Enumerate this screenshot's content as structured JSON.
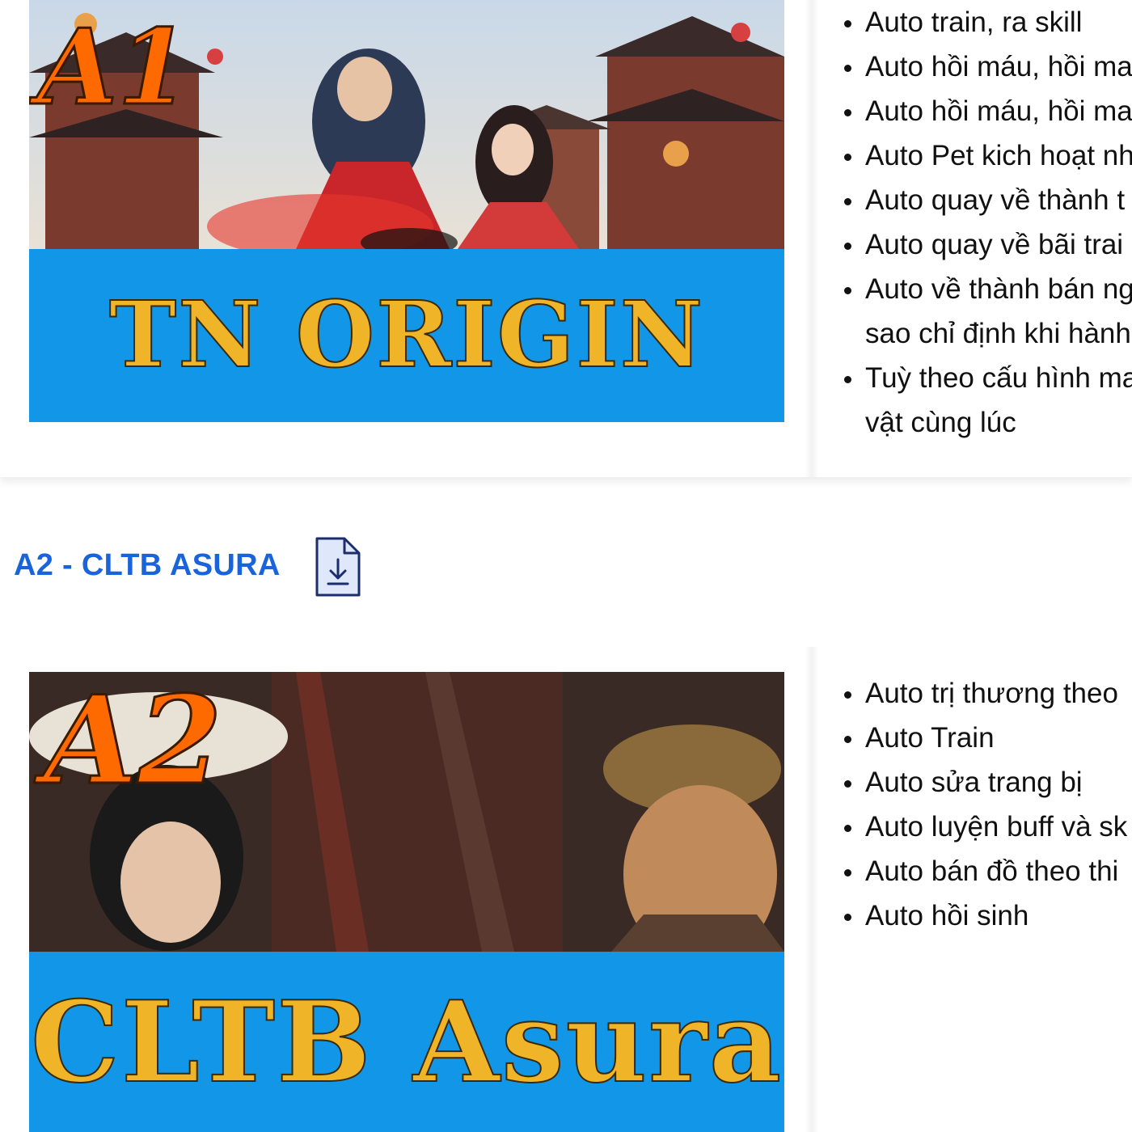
{
  "sections": [
    {
      "banner": {
        "badge": "A1",
        "title": "TN ORIGIN"
      },
      "features": [
        "Auto train, ra skill",
        "Auto hồi máu, hồi ma",
        "Auto hồi máu, hồi ma",
        "Auto Pet kich hoạt nh",
        "Auto quay về thành t",
        "Auto quay về bãi trai",
        "Auto về thành bán ng",
        "sao chỉ định khi hành",
        "Tuỳ theo cấu hình ma",
        "vật cùng lúc"
      ]
    },
    {
      "header": {
        "title": "A2 - CLTB ASURA",
        "icon": "download-file-icon"
      },
      "banner": {
        "badge": "A2",
        "title": "CLTB Asura"
      },
      "features": [
        "Auto trị thương theo",
        "Auto Train",
        "Auto sửa trang bị",
        "Auto luyện buff và sk",
        "Auto bán đồ theo thi",
        "Auto hồi sinh"
      ]
    }
  ],
  "colors": {
    "link": "#1a64db",
    "banner_blue": "#1296e8",
    "title_gold": "#f0b429",
    "badge_orange": "#ff6a00"
  }
}
